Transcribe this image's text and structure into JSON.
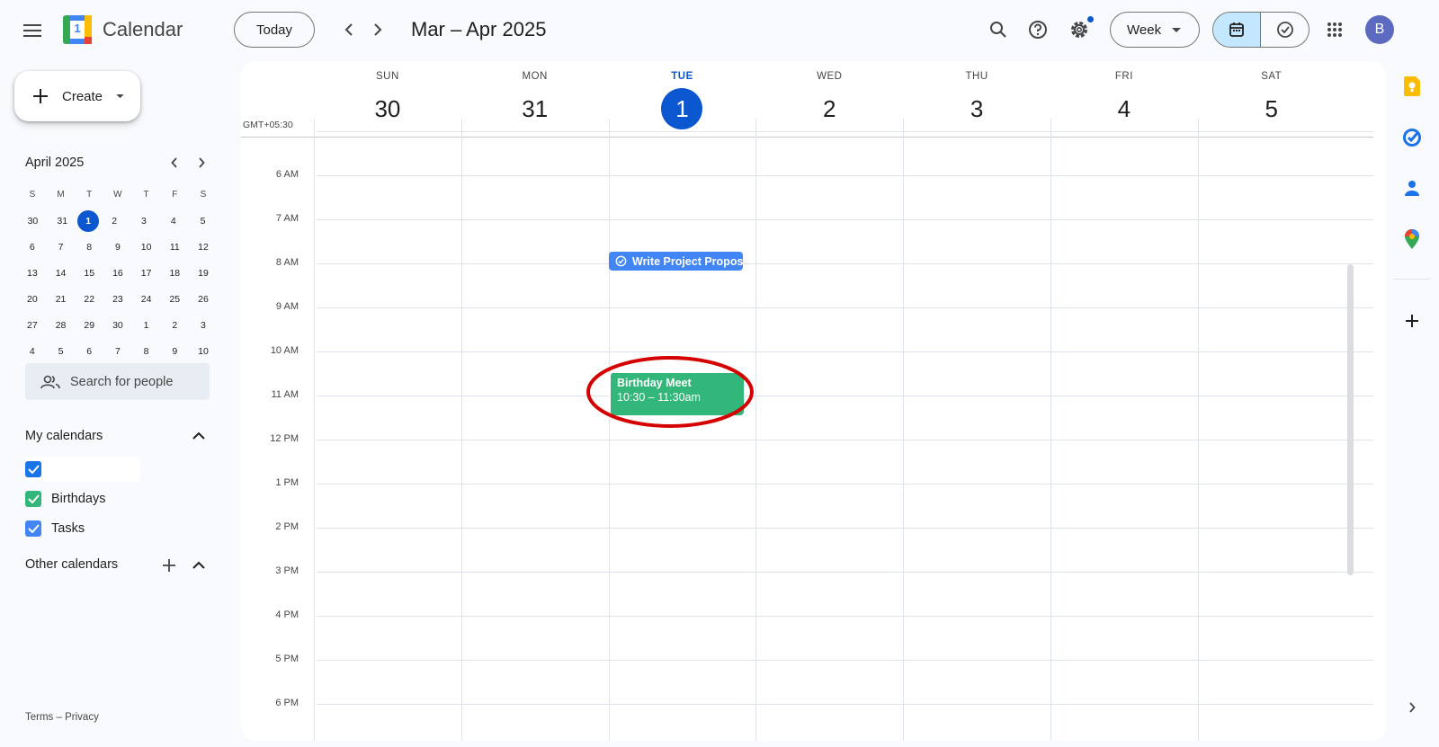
{
  "app": {
    "title": "Calendar",
    "logo_day": "1"
  },
  "header": {
    "today_label": "Today",
    "date_range": "Mar – Apr 2025",
    "view_label": "Week",
    "avatar_initial": "B"
  },
  "sidebar": {
    "create_label": "Create",
    "mini_calendar": {
      "month_label": "April 2025",
      "weekday_headers": [
        "S",
        "M",
        "T",
        "W",
        "T",
        "F",
        "S"
      ],
      "weeks": [
        [
          "30",
          "31",
          "1",
          "2",
          "3",
          "4",
          "5"
        ],
        [
          "6",
          "7",
          "8",
          "9",
          "10",
          "11",
          "12"
        ],
        [
          "13",
          "14",
          "15",
          "16",
          "17",
          "18",
          "19"
        ],
        [
          "20",
          "21",
          "22",
          "23",
          "24",
          "25",
          "26"
        ],
        [
          "27",
          "28",
          "29",
          "30",
          "1",
          "2",
          "3"
        ],
        [
          "4",
          "5",
          "6",
          "7",
          "8",
          "9",
          "10"
        ]
      ],
      "today": "1"
    },
    "search_people_placeholder": "Search for people",
    "my_calendars_label": "My calendars",
    "calendars": [
      {
        "label": "",
        "color": "#1a73e8",
        "checked": true
      },
      {
        "label": "Birthdays",
        "color": "#33b679",
        "checked": true
      },
      {
        "label": "Tasks",
        "color": "#4285f4",
        "checked": true
      }
    ],
    "other_calendars_label": "Other calendars",
    "footer": {
      "terms": "Terms",
      "separator": "–",
      "privacy": "Privacy"
    }
  },
  "week": {
    "timezone": "GMT+05:30",
    "days": [
      {
        "name": "SUN",
        "num": "30"
      },
      {
        "name": "MON",
        "num": "31"
      },
      {
        "name": "TUE",
        "num": "1",
        "today": true
      },
      {
        "name": "WED",
        "num": "2"
      },
      {
        "name": "THU",
        "num": "3"
      },
      {
        "name": "FRI",
        "num": "4"
      },
      {
        "name": "SAT",
        "num": "5"
      }
    ],
    "time_labels": [
      "6 AM",
      "7 AM",
      "8 AM",
      "9 AM",
      "10 AM",
      "11 AM",
      "12 PM",
      "1 PM",
      "2 PM",
      "3 PM",
      "4 PM",
      "5 PM",
      "6 PM"
    ]
  },
  "events": {
    "task": {
      "title": "Write Project Proposal",
      "color": "#4285f4"
    },
    "birthday": {
      "title": "Birthday Meet",
      "time": "10:30 – 11:30am",
      "color": "#33b679"
    }
  },
  "colors": {
    "accent": "#0b57d0",
    "highlight_ring": "#d50000"
  }
}
